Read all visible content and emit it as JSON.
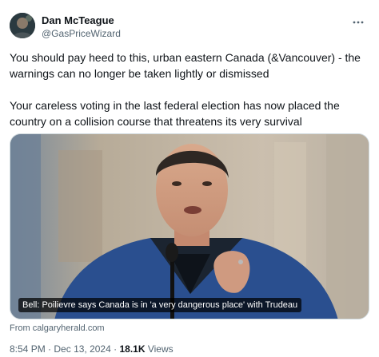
{
  "author": {
    "display_name": "Dan McTeague",
    "handle": "@GasPriceWizard",
    "avatar_icon": "user-avatar"
  },
  "more_icon": "ellipsis-icon",
  "tweet": {
    "paragraphs": [
      "You should pay heed to this, urban eastern Canada (&Vancouver) - the warnings can no longer be taken lightly or dismissed",
      "Your careless voting in the last federal election has now placed the country on a collision course that threatens its very survival"
    ]
  },
  "link_card": {
    "caption": "Bell: Poilievre says Canada is in 'a very dangerous place' with Trudeau",
    "source": "From calgaryherald.com"
  },
  "meta": {
    "time": "8:54 PM",
    "date": "Dec 13, 2024",
    "separator": "·",
    "views_count": "18.1K",
    "views_label": "Views"
  },
  "colors": {
    "text_primary": "#0f1419",
    "text_secondary": "#536471",
    "border": "#cfd9de",
    "jacket": "#2a4f8f"
  }
}
